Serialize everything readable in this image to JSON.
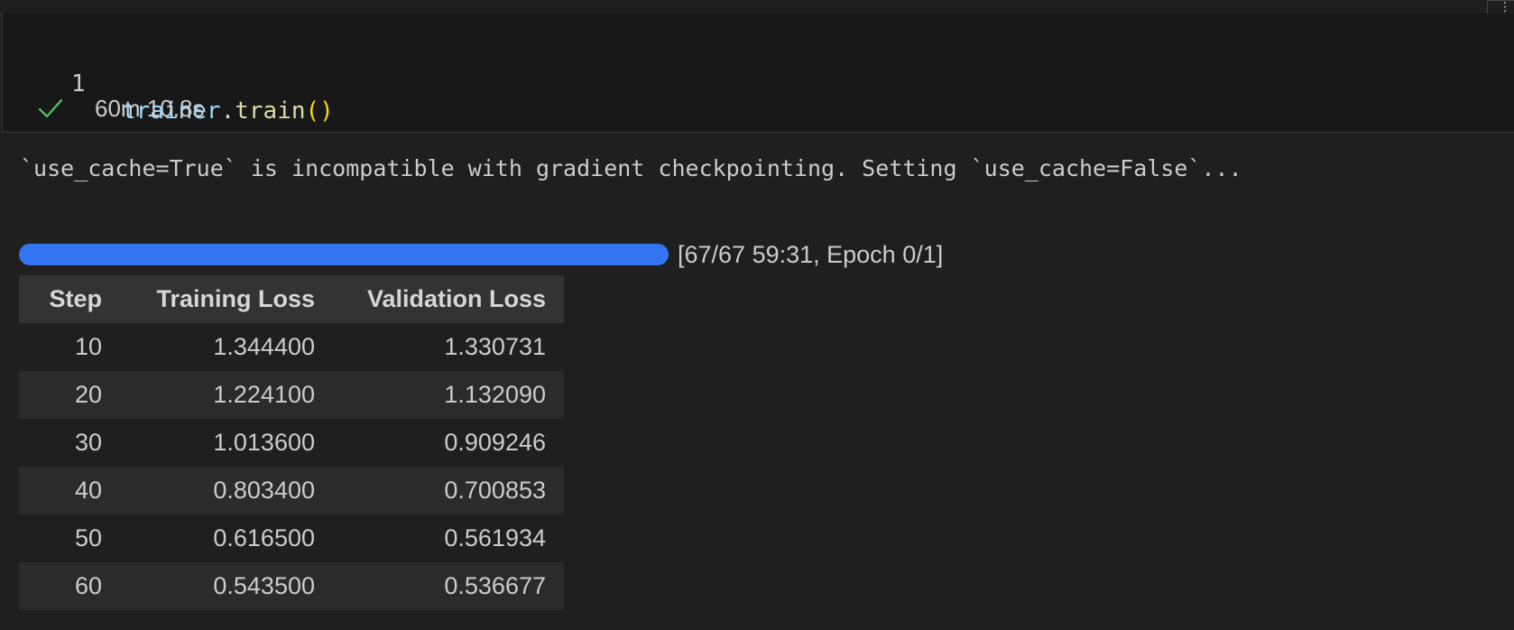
{
  "code_cell": {
    "line_number": "1",
    "code": {
      "object": "trainer",
      "dot": ".",
      "method": "train",
      "parens": "()"
    },
    "status_icon": "check-icon",
    "execution_time": "60m 10.8s"
  },
  "output": {
    "warning": "`use_cache=True` is incompatible with gradient checkpointing. Setting `use_cache=False`...",
    "progress": {
      "fraction": 1.0,
      "label": "[67/67 59:31, Epoch 0/1]"
    },
    "table": {
      "headers": [
        "Step",
        "Training Loss",
        "Validation Loss"
      ],
      "rows": [
        {
          "step": "10",
          "training_loss": "1.344400",
          "validation_loss": "1.330731"
        },
        {
          "step": "20",
          "training_loss": "1.224100",
          "validation_loss": "1.132090"
        },
        {
          "step": "30",
          "training_loss": "1.013600",
          "validation_loss": "0.909246"
        },
        {
          "step": "40",
          "training_loss": "0.803400",
          "validation_loss": "0.700853"
        },
        {
          "step": "50",
          "training_loss": "0.616500",
          "validation_loss": "0.561934"
        },
        {
          "step": "60",
          "training_loss": "0.543500",
          "validation_loss": "0.536677"
        }
      ]
    }
  },
  "colors": {
    "progress_fill": "#3574f0",
    "check_icon": "#4ec96b"
  }
}
